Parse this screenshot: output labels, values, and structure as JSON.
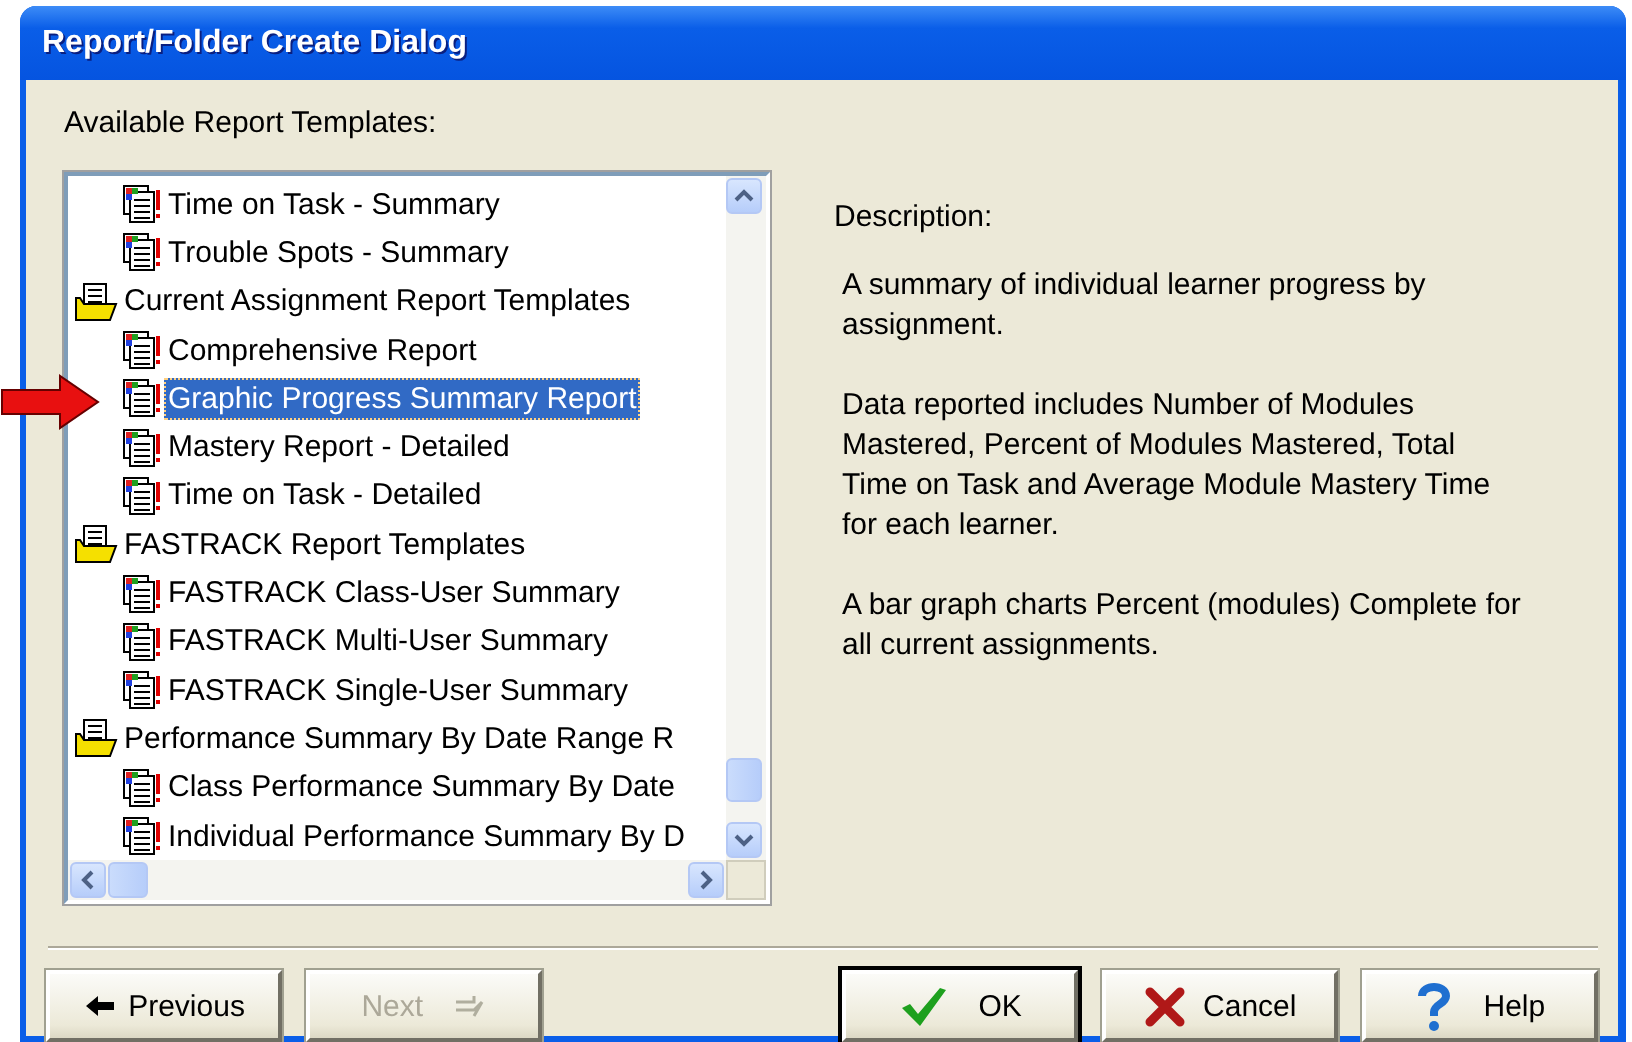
{
  "window": {
    "title": "Report/Folder Create Dialog"
  },
  "templates_label": "Available Report Templates:",
  "tree": [
    {
      "kind": "folder",
      "children": [
        {
          "kind": "report",
          "label": "Time on Task - Summary",
          "selected": false
        },
        {
          "kind": "report",
          "label": "Trouble Spots - Summary",
          "selected": false
        }
      ]
    },
    {
      "kind": "folder",
      "label": "Current Assignment Report Templates",
      "expanded": true,
      "selected": false,
      "children": [
        {
          "kind": "report",
          "label": "Comprehensive Report",
          "selected": false
        },
        {
          "kind": "report",
          "label": "Graphic Progress Summary Report",
          "selected": true
        },
        {
          "kind": "report",
          "label": "Mastery Report - Detailed",
          "selected": false
        },
        {
          "kind": "report",
          "label": "Time on Task - Detailed",
          "selected": false
        }
      ]
    },
    {
      "kind": "folder",
      "label": "FASTRACK Report Templates",
      "expanded": true,
      "selected": false,
      "children": [
        {
          "kind": "report",
          "label": "FASTRACK Class-User Summary",
          "selected": false
        },
        {
          "kind": "report",
          "label": "FASTRACK Multi-User Summary",
          "selected": false
        },
        {
          "kind": "report",
          "label": "FASTRACK Single-User Summary",
          "selected": false
        }
      ]
    },
    {
      "kind": "folder",
      "label": "Performance Summary By Date Range R",
      "expanded": true,
      "selected": false,
      "children": [
        {
          "kind": "report",
          "label": "Class Performance Summary By Date",
          "selected": false
        },
        {
          "kind": "report",
          "label": "Individual Performance Summary By D",
          "selected": false
        }
      ]
    }
  ],
  "description": {
    "heading": "Description:",
    "paragraphs": [
      "A summary of individual learner progress by assignment.",
      "Data reported includes Number of Modules Mastered, Percent of Modules Mastered, Total Time on Task and Average Module Mastery Time for each learner.",
      "A bar graph charts Percent (modules) Complete for all current assignments."
    ]
  },
  "nav_buttons": [
    {
      "kind": "previous",
      "label": "Previous",
      "disabled": false
    },
    {
      "kind": "next",
      "label": "Next",
      "disabled": true
    }
  ],
  "action_buttons": [
    {
      "kind": "ok",
      "label": "OK",
      "disabled": false,
      "default": true
    },
    {
      "kind": "cancel",
      "label": "Cancel",
      "disabled": false,
      "default": false
    },
    {
      "kind": "help",
      "label": "Help",
      "disabled": false,
      "default": false
    }
  ]
}
